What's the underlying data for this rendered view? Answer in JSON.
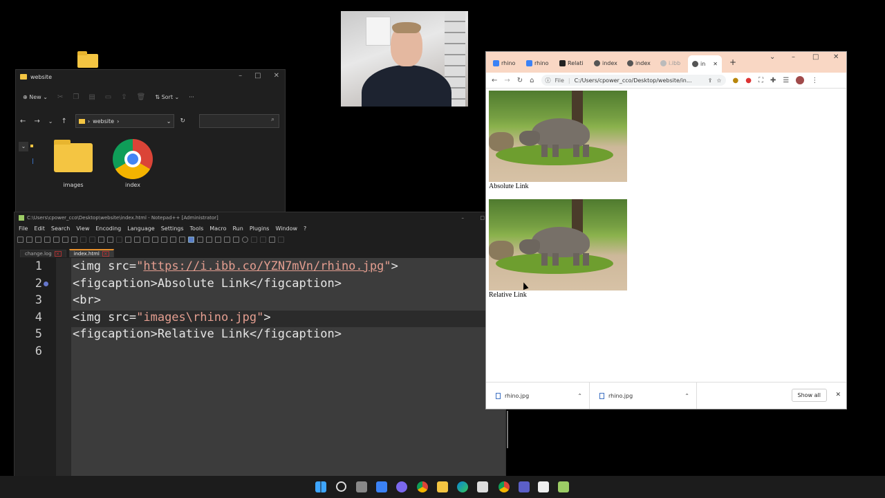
{
  "explorer": {
    "title": "website",
    "new_label": "New",
    "sort_label": "Sort",
    "more_label": "···",
    "breadcrumb": "website",
    "items": [
      {
        "name": "images",
        "type": "folder"
      },
      {
        "name": "index",
        "type": "chrome-html"
      }
    ]
  },
  "notepad": {
    "title": "C:\\Users\\cpower_cco\\Desktop\\website\\index.html - Notepad++ [Administrator]",
    "menu": [
      "File",
      "Edit",
      "Search",
      "View",
      "Encoding",
      "Language",
      "Settings",
      "Tools",
      "Macro",
      "Run",
      "Plugins",
      "Window",
      "?"
    ],
    "tabs": [
      {
        "label": "change.log",
        "active": false
      },
      {
        "label": "index.html",
        "active": true
      }
    ],
    "line_numbers": [
      "1",
      "2",
      "3",
      "4",
      "5",
      "6"
    ],
    "code": {
      "l1_open": "<img src=",
      "l1_q1": "\"",
      "l1_url": "https://i.ibb.co/YZN7mVn/rhino.jpg",
      "l1_q2": "\"",
      "l1_close": ">",
      "l2": "<figcaption>Absolute Link</figcaption>",
      "l3": "<br>",
      "l4_open": "<img src=",
      "l4_str": "\"images\\rhino.jpg\"",
      "l4_close": ">",
      "l5": "<figcaption>Relative Link</figcaption>",
      "l6": ""
    }
  },
  "chrome": {
    "tabs": [
      "rhino",
      "rhino",
      "Relati",
      "index",
      "index",
      "i.ibb",
      "in"
    ],
    "new_tab": "+",
    "address_prefix": "File",
    "address": "C:/Users/cpower_cco/Desktop/website/in...",
    "captions": [
      "Absolute Link",
      "Relative Link"
    ],
    "downloads": [
      "rhino.jpg",
      "rhino.jpg"
    ],
    "show_all": "Show all",
    "close_glyph": "✕"
  },
  "colors": {
    "chrome_tabstrip": "#f9d7c4",
    "editor_bg": "#3c3c3c",
    "string_color": "#e49e90",
    "folder": "#f4c542"
  },
  "taskbar_icons": [
    "windows-start-icon",
    "search-icon",
    "task-view-icon",
    "widgets-icon",
    "teams-chat-icon",
    "chrome-icon",
    "file-explorer-icon",
    "edge-icon",
    "store-icon",
    "chrome-active-icon",
    "teams-icon",
    "paint-icon",
    "notepad-plus-plus-icon"
  ]
}
